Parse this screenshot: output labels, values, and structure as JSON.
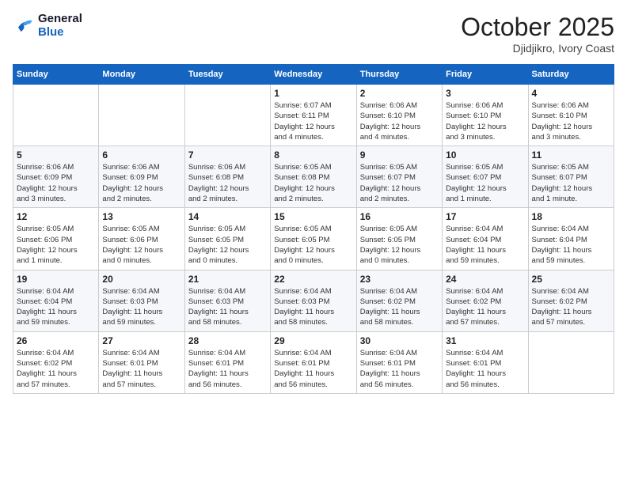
{
  "header": {
    "logo_line1": "General",
    "logo_line2": "Blue",
    "month": "October 2025",
    "location": "Djidjikro, Ivory Coast"
  },
  "weekdays": [
    "Sunday",
    "Monday",
    "Tuesday",
    "Wednesday",
    "Thursday",
    "Friday",
    "Saturday"
  ],
  "weeks": [
    [
      {
        "day": "",
        "info": ""
      },
      {
        "day": "",
        "info": ""
      },
      {
        "day": "",
        "info": ""
      },
      {
        "day": "1",
        "info": "Sunrise: 6:07 AM\nSunset: 6:11 PM\nDaylight: 12 hours\nand 4 minutes."
      },
      {
        "day": "2",
        "info": "Sunrise: 6:06 AM\nSunset: 6:10 PM\nDaylight: 12 hours\nand 4 minutes."
      },
      {
        "day": "3",
        "info": "Sunrise: 6:06 AM\nSunset: 6:10 PM\nDaylight: 12 hours\nand 3 minutes."
      },
      {
        "day": "4",
        "info": "Sunrise: 6:06 AM\nSunset: 6:10 PM\nDaylight: 12 hours\nand 3 minutes."
      }
    ],
    [
      {
        "day": "5",
        "info": "Sunrise: 6:06 AM\nSunset: 6:09 PM\nDaylight: 12 hours\nand 3 minutes."
      },
      {
        "day": "6",
        "info": "Sunrise: 6:06 AM\nSunset: 6:09 PM\nDaylight: 12 hours\nand 2 minutes."
      },
      {
        "day": "7",
        "info": "Sunrise: 6:06 AM\nSunset: 6:08 PM\nDaylight: 12 hours\nand 2 minutes."
      },
      {
        "day": "8",
        "info": "Sunrise: 6:05 AM\nSunset: 6:08 PM\nDaylight: 12 hours\nand 2 minutes."
      },
      {
        "day": "9",
        "info": "Sunrise: 6:05 AM\nSunset: 6:07 PM\nDaylight: 12 hours\nand 2 minutes."
      },
      {
        "day": "10",
        "info": "Sunrise: 6:05 AM\nSunset: 6:07 PM\nDaylight: 12 hours\nand 1 minute."
      },
      {
        "day": "11",
        "info": "Sunrise: 6:05 AM\nSunset: 6:07 PM\nDaylight: 12 hours\nand 1 minute."
      }
    ],
    [
      {
        "day": "12",
        "info": "Sunrise: 6:05 AM\nSunset: 6:06 PM\nDaylight: 12 hours\nand 1 minute."
      },
      {
        "day": "13",
        "info": "Sunrise: 6:05 AM\nSunset: 6:06 PM\nDaylight: 12 hours\nand 0 minutes."
      },
      {
        "day": "14",
        "info": "Sunrise: 6:05 AM\nSunset: 6:05 PM\nDaylight: 12 hours\nand 0 minutes."
      },
      {
        "day": "15",
        "info": "Sunrise: 6:05 AM\nSunset: 6:05 PM\nDaylight: 12 hours\nand 0 minutes."
      },
      {
        "day": "16",
        "info": "Sunrise: 6:05 AM\nSunset: 6:05 PM\nDaylight: 12 hours\nand 0 minutes."
      },
      {
        "day": "17",
        "info": "Sunrise: 6:04 AM\nSunset: 6:04 PM\nDaylight: 11 hours\nand 59 minutes."
      },
      {
        "day": "18",
        "info": "Sunrise: 6:04 AM\nSunset: 6:04 PM\nDaylight: 11 hours\nand 59 minutes."
      }
    ],
    [
      {
        "day": "19",
        "info": "Sunrise: 6:04 AM\nSunset: 6:04 PM\nDaylight: 11 hours\nand 59 minutes."
      },
      {
        "day": "20",
        "info": "Sunrise: 6:04 AM\nSunset: 6:03 PM\nDaylight: 11 hours\nand 59 minutes."
      },
      {
        "day": "21",
        "info": "Sunrise: 6:04 AM\nSunset: 6:03 PM\nDaylight: 11 hours\nand 58 minutes."
      },
      {
        "day": "22",
        "info": "Sunrise: 6:04 AM\nSunset: 6:03 PM\nDaylight: 11 hours\nand 58 minutes."
      },
      {
        "day": "23",
        "info": "Sunrise: 6:04 AM\nSunset: 6:02 PM\nDaylight: 11 hours\nand 58 minutes."
      },
      {
        "day": "24",
        "info": "Sunrise: 6:04 AM\nSunset: 6:02 PM\nDaylight: 11 hours\nand 57 minutes."
      },
      {
        "day": "25",
        "info": "Sunrise: 6:04 AM\nSunset: 6:02 PM\nDaylight: 11 hours\nand 57 minutes."
      }
    ],
    [
      {
        "day": "26",
        "info": "Sunrise: 6:04 AM\nSunset: 6:02 PM\nDaylight: 11 hours\nand 57 minutes."
      },
      {
        "day": "27",
        "info": "Sunrise: 6:04 AM\nSunset: 6:01 PM\nDaylight: 11 hours\nand 57 minutes."
      },
      {
        "day": "28",
        "info": "Sunrise: 6:04 AM\nSunset: 6:01 PM\nDaylight: 11 hours\nand 56 minutes."
      },
      {
        "day": "29",
        "info": "Sunrise: 6:04 AM\nSunset: 6:01 PM\nDaylight: 11 hours\nand 56 minutes."
      },
      {
        "day": "30",
        "info": "Sunrise: 6:04 AM\nSunset: 6:01 PM\nDaylight: 11 hours\nand 56 minutes."
      },
      {
        "day": "31",
        "info": "Sunrise: 6:04 AM\nSunset: 6:01 PM\nDaylight: 11 hours\nand 56 minutes."
      },
      {
        "day": "",
        "info": ""
      }
    ]
  ]
}
